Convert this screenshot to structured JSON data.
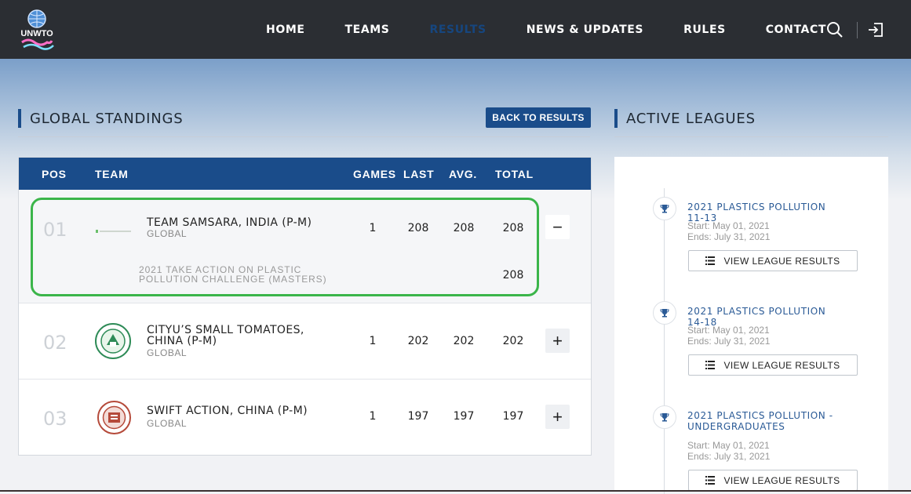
{
  "nav": {
    "logo_text": "UNWTO",
    "items": [
      {
        "label": "HOME"
      },
      {
        "label": "TEAMS"
      },
      {
        "label": "RESULTS"
      },
      {
        "label": "NEWS & UPDATES"
      },
      {
        "label": "RULES"
      },
      {
        "label": "CONTACT"
      }
    ],
    "active_item": "RESULTS",
    "active_color": "#16467f"
  },
  "standings": {
    "title": "GLOBAL STANDINGS",
    "back_button": "BACK TO RESULTS",
    "columns": {
      "pos": "POS",
      "team": "TEAM",
      "games": "GAMES",
      "last": "LAST",
      "avg": "AVG.",
      "total": "TOTAL"
    },
    "rows": [
      {
        "pos": "01",
        "name": "TEAM SAMSARA, INDIA (P-M)",
        "scope": "GLOBAL",
        "games": "1",
        "last": "208",
        "avg": "208",
        "total": "208",
        "toggle": "−",
        "detail": {
          "challenge": "2021 TAKE ACTION ON PLASTIC POLLUTION CHALLENGE (MASTERS)",
          "total": "208"
        }
      },
      {
        "pos": "02",
        "name": "CITYU’S SMALL TOMATOES, CHINA (P-M)",
        "scope": "GLOBAL",
        "games": "1",
        "last": "202",
        "avg": "202",
        "total": "202",
        "toggle": "+"
      },
      {
        "pos": "03",
        "name": "SWIFT ACTION, CHINA (P-M)",
        "scope": "GLOBAL",
        "games": "1",
        "last": "197",
        "avg": "197",
        "total": "197",
        "toggle": "+"
      }
    ]
  },
  "leagues": {
    "title": "ACTIVE LEAGUES",
    "items": [
      {
        "name": "2021 PLASTICS POLLUTION 11-13",
        "start": "Start: May 01, 2021",
        "end": "Ends: July 31, 2021",
        "button": "VIEW LEAGUE RESULTS"
      },
      {
        "name": "2021 PLASTICS POLLUTION 14-18",
        "start": "Start: May 01, 2021",
        "end": "Ends: July 31, 2021",
        "button": "VIEW LEAGUE RESULTS"
      },
      {
        "name": "2021 PLASTICS POLLUTION - UNDERGRADUATES",
        "start": "Start: May 01, 2021",
        "end": "Ends: July 31, 2021",
        "button": "VIEW LEAGUE RESULTS"
      }
    ]
  },
  "colors": {
    "primary": "#1a4c8a",
    "highlight": "#3bb54a",
    "nav_bg": "#2b2e33"
  }
}
